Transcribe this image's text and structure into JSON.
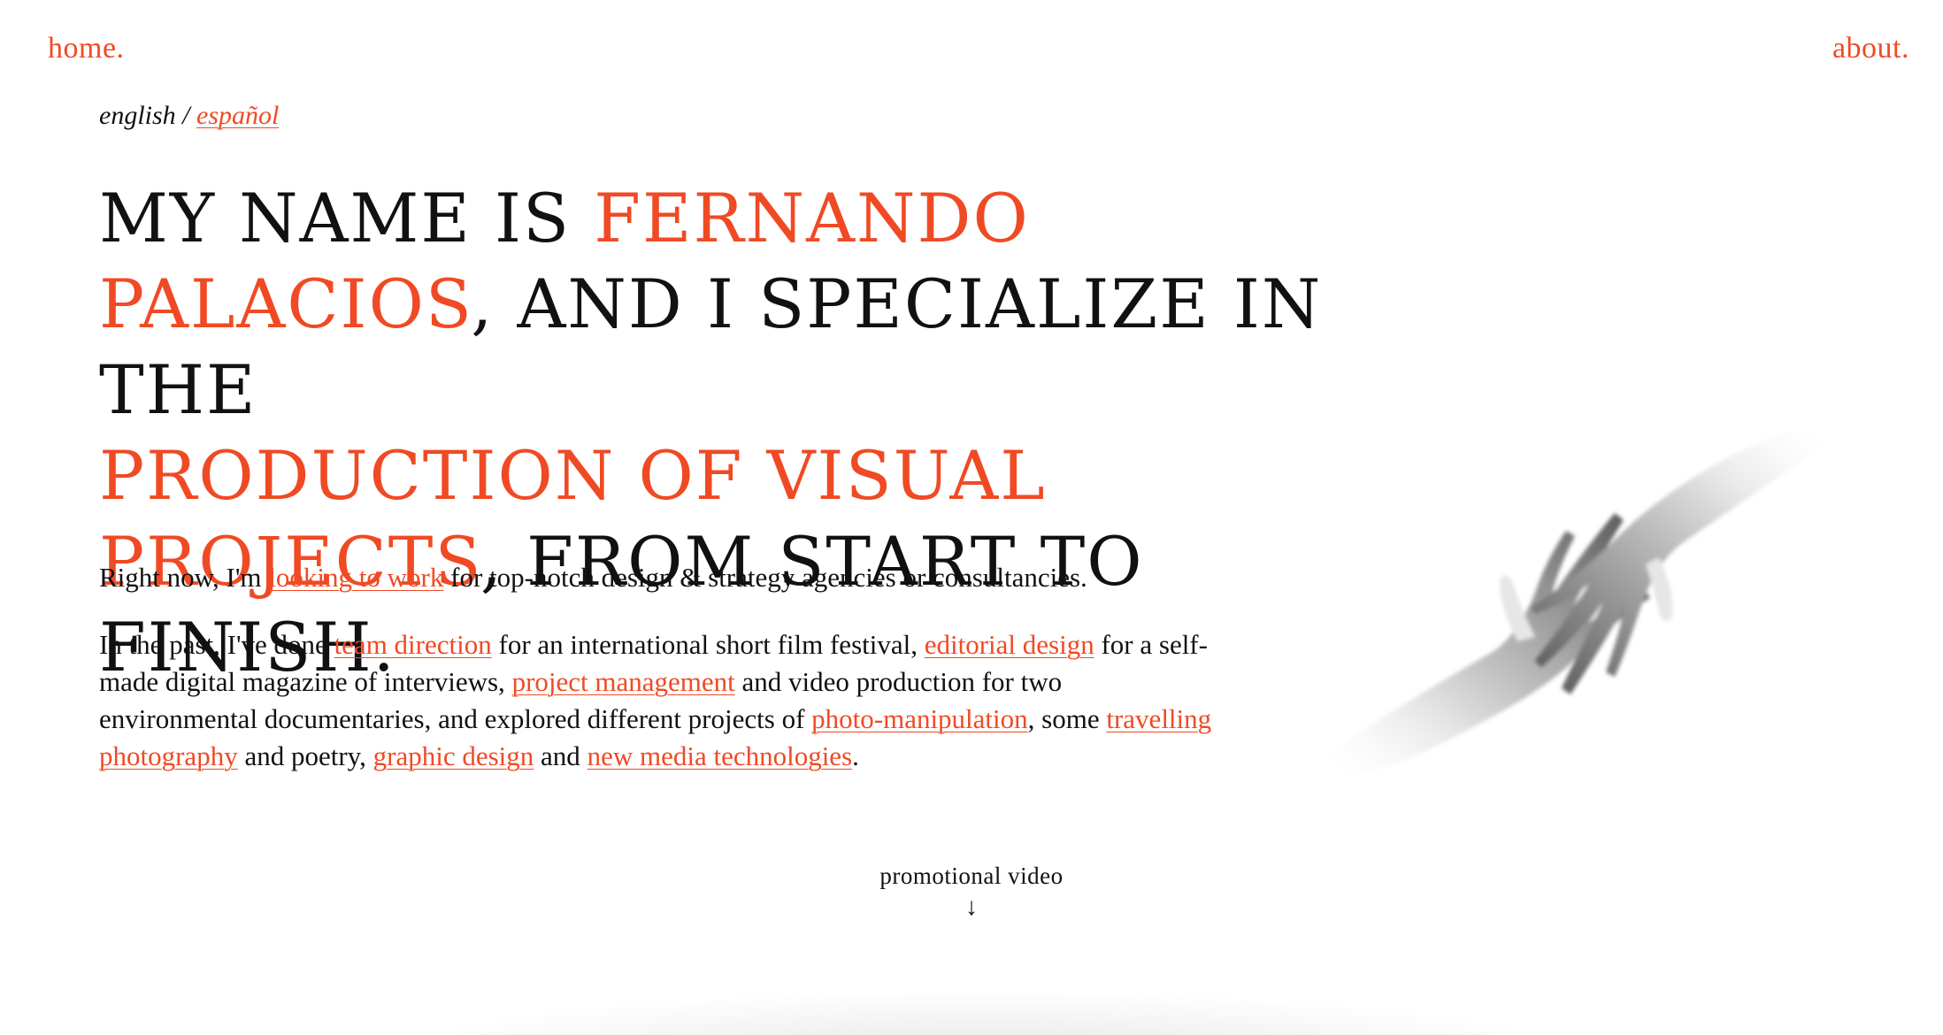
{
  "nav": {
    "home": "home.",
    "about": "about."
  },
  "language": {
    "current": "english",
    "separator": " / ",
    "alternate": "español"
  },
  "headline": {
    "part1": "My name is ",
    "name": "Fernando Palacios",
    "part2": ", and I specialize in the ",
    "focus": "production of visual projects",
    "part3": ", from start to finish."
  },
  "intro": {
    "p1_before": "Right now, I'm ",
    "p1_link": "looking to work",
    "p1_after": " for top-notch design & strategy agencies or consultancies.",
    "p2_t1": "In the past, I've done ",
    "p2_l1": "team direction",
    "p2_t2": " for an international short film festival, ",
    "p2_l2": "editorial design",
    "p2_t3": " for a self-made digital magazine of interviews, ",
    "p2_l3": "project management",
    "p2_t4": " and video production for two environmental documentaries, and explored different projects of ",
    "p2_l4": "photo-manipulation",
    "p2_t5": ", some ",
    "p2_l5": "travelling photography",
    "p2_t6": " and poetry, ",
    "p2_l6": "graphic design",
    "p2_t7": " and ",
    "p2_l7": "new media technologies",
    "p2_t8": "."
  },
  "video": {
    "label": "promotional video",
    "arrow": "↓"
  },
  "colors": {
    "accent": "#f04a24",
    "text": "#111111",
    "background": "#ffffff"
  }
}
